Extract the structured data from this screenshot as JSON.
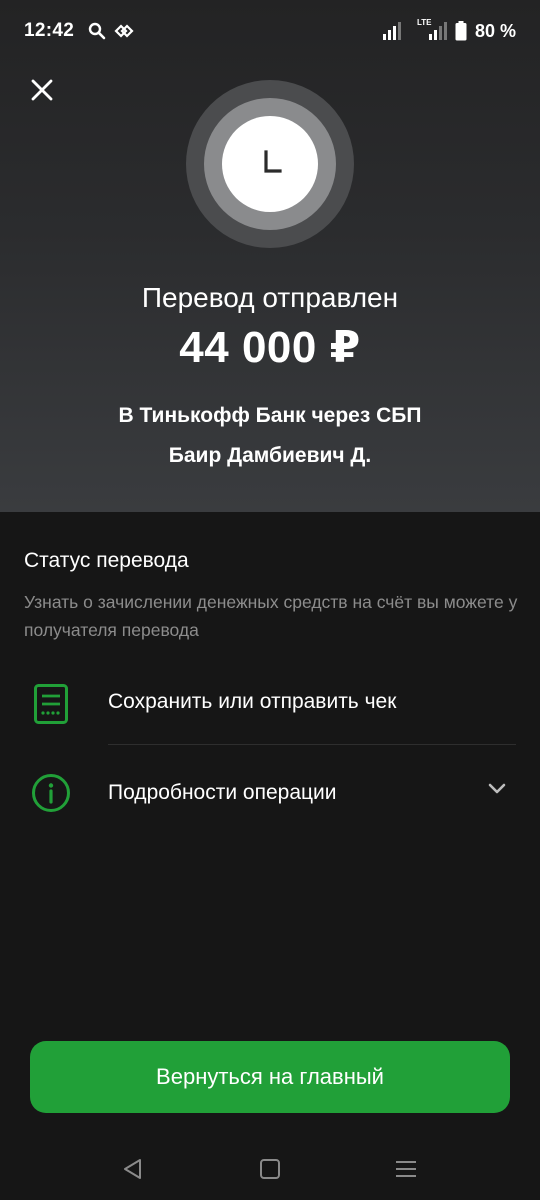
{
  "status_bar": {
    "time": "12:42",
    "network_type": "LTE",
    "battery_percent": "80 %"
  },
  "header": {
    "title": "Перевод отправлен",
    "amount": "44 000 ₽",
    "bank_line": "В Тинькофф Банк через СБП",
    "recipient": "Баир Дамбиевич Д."
  },
  "status_section": {
    "title": "Статус перевода",
    "description": "Узнать о зачислении денежных средств на счёт вы можете у получателя перевода"
  },
  "actions": {
    "receipt_label": "Сохранить или отправить чек",
    "details_label": "Подробности операции"
  },
  "main_button": {
    "label": "Вернуться на главный"
  },
  "colors": {
    "accent_green": "#21a038",
    "background": "#161616",
    "muted_text": "#8c8c8c"
  },
  "icons": [
    "close-icon",
    "clock-icon",
    "receipt-icon",
    "info-icon",
    "chevron-down-icon",
    "back-nav-icon",
    "home-nav-icon",
    "recents-nav-icon"
  ]
}
